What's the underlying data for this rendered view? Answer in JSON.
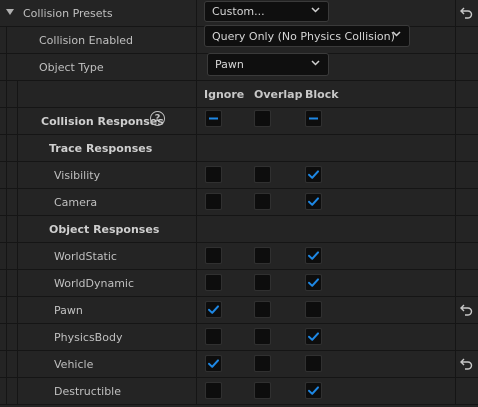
{
  "preset": {
    "label": "Collision Presets",
    "value": "Custom..."
  },
  "enabled": {
    "label": "Collision Enabled",
    "value": "Query Only (No Physics Collision)"
  },
  "object_type": {
    "label": "Object Type",
    "value": "Pawn"
  },
  "columns": {
    "ignore": "Ignore",
    "overlap": "Overlap",
    "block": "Block"
  },
  "collision_responses": {
    "label": "Collision Responses",
    "help": "?"
  },
  "trace_responses": "Trace Responses",
  "object_responses": "Object Responses",
  "trace_rows": [
    {
      "label": "Visibility",
      "value": "block"
    },
    {
      "label": "Camera",
      "value": "block"
    }
  ],
  "object_rows": [
    {
      "label": "WorldStatic",
      "value": "block",
      "modified": false
    },
    {
      "label": "WorldDynamic",
      "value": "block",
      "modified": false
    },
    {
      "label": "Pawn",
      "value": "ignore",
      "modified": true
    },
    {
      "label": "PhysicsBody",
      "value": "block",
      "modified": false
    },
    {
      "label": "Vehicle",
      "value": "ignore",
      "modified": true
    },
    {
      "label": "Destructible",
      "value": "block",
      "modified": false
    }
  ],
  "colors": {
    "accent": "#1e88e5",
    "background": "#242424"
  }
}
